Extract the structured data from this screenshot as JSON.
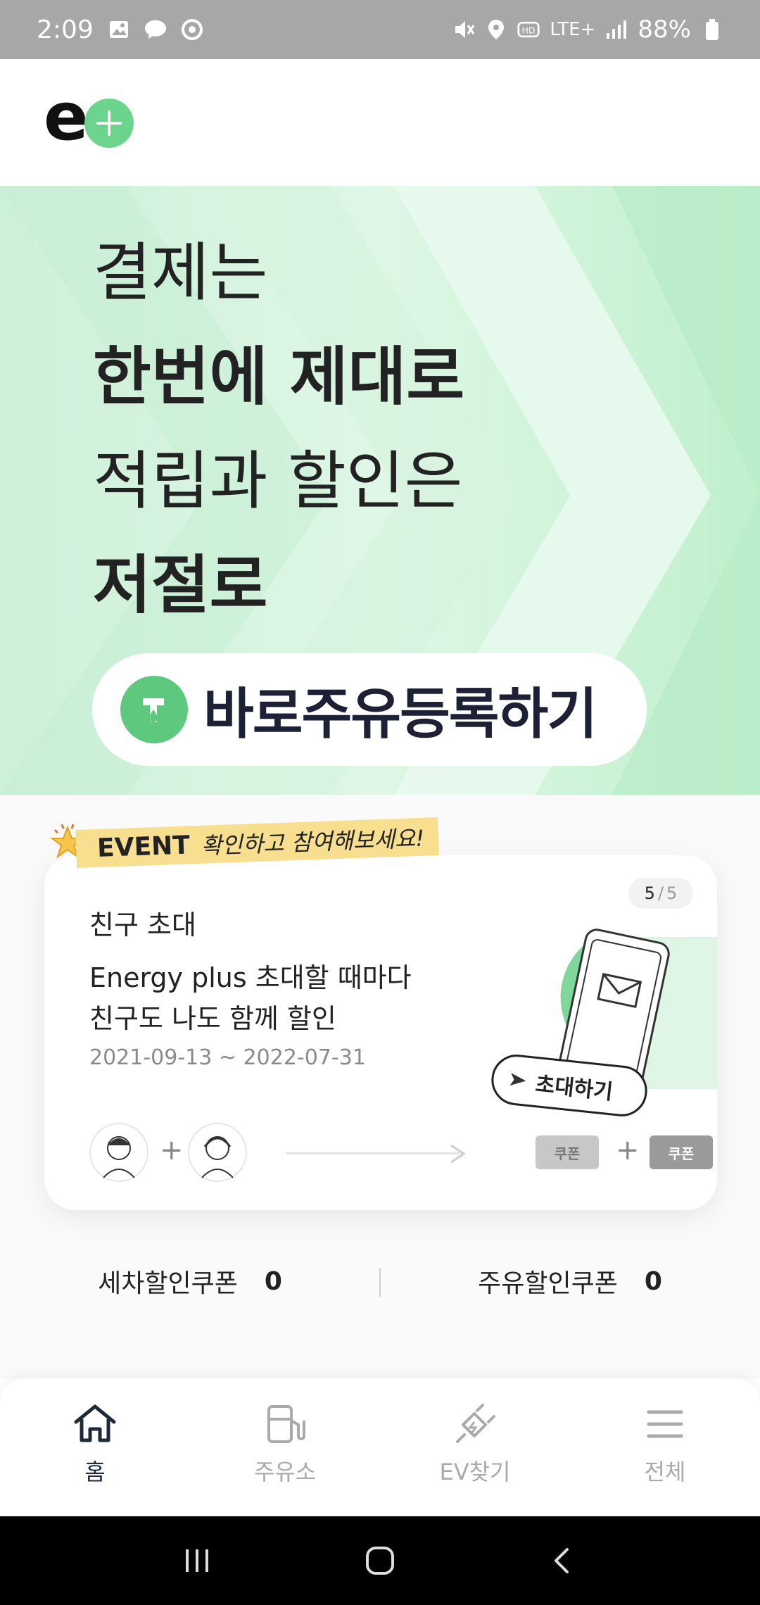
{
  "status_bar": {
    "time": "2:09",
    "network": "LTE+",
    "battery": "88%"
  },
  "hero": {
    "line1": "결제는",
    "line2": "한번에 제대로",
    "line3": "적립과 할인은",
    "line4": "저절로",
    "register_button": "바로주유등록하기"
  },
  "event": {
    "tag_word": "EVENT",
    "tag_note": "확인하고 참여해보세요!",
    "page_current": "5",
    "page_total": "5",
    "category": "친구 초대",
    "title_line1": "Energy plus 초대할 때마다",
    "title_line2": "친구도 나도 함께 할인",
    "date_range": "2021-09-13 ~ 2022-07-31",
    "invite_label": "초대하기",
    "coupon_label_1": "쿠폰",
    "coupon_label_2": "쿠폰"
  },
  "coupons": {
    "wash_label": "세차할인쿠폰",
    "wash_count": "0",
    "fuel_label": "주유할인쿠폰",
    "fuel_count": "0"
  },
  "bottom_nav": {
    "items": [
      {
        "label": "홈",
        "icon": "home-icon",
        "active": true
      },
      {
        "label": "주유소",
        "icon": "fuel-station-icon",
        "active": false
      },
      {
        "label": "EV찾기",
        "icon": "ev-plug-icon",
        "active": false
      },
      {
        "label": "전체",
        "icon": "menu-icon",
        "active": false
      }
    ]
  },
  "colors": {
    "brand_green": "#6cd48d",
    "hero_bg": "#cdf0d8",
    "event_tag": "#f8df8f",
    "nav_active": "#1e2a3a"
  }
}
